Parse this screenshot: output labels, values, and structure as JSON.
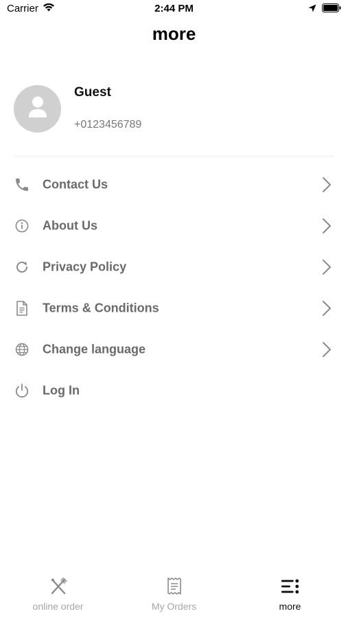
{
  "status_bar": {
    "carrier": "Carrier",
    "time": "2:44 PM"
  },
  "header": {
    "title": "more"
  },
  "profile": {
    "name": "Guest",
    "phone": "+0123456789"
  },
  "menu": {
    "items": [
      {
        "label": "Contact Us",
        "icon": "phone-icon",
        "has_chevron": true
      },
      {
        "label": "About Us",
        "icon": "info-icon",
        "has_chevron": true
      },
      {
        "label": "Privacy Policy",
        "icon": "refresh-icon",
        "has_chevron": true
      },
      {
        "label": "Terms & Conditions",
        "icon": "document-icon",
        "has_chevron": true
      },
      {
        "label": "Change language",
        "icon": "globe-icon",
        "has_chevron": true
      },
      {
        "label": "Log In",
        "icon": "power-icon",
        "has_chevron": false
      }
    ]
  },
  "tab_bar": {
    "tabs": [
      {
        "label": "online order",
        "icon": "utensils-icon",
        "active": false
      },
      {
        "label": "My Orders",
        "icon": "receipt-icon",
        "active": false
      },
      {
        "label": "more",
        "icon": "menu-list-icon",
        "active": true
      }
    ]
  },
  "colors": {
    "icon_gray": "#8a8a8a",
    "label_gray": "#6a6a6a",
    "tab_inactive": "#a6a6a6",
    "tab_active": "#111111",
    "avatar_bg": "#d0d0d0"
  }
}
